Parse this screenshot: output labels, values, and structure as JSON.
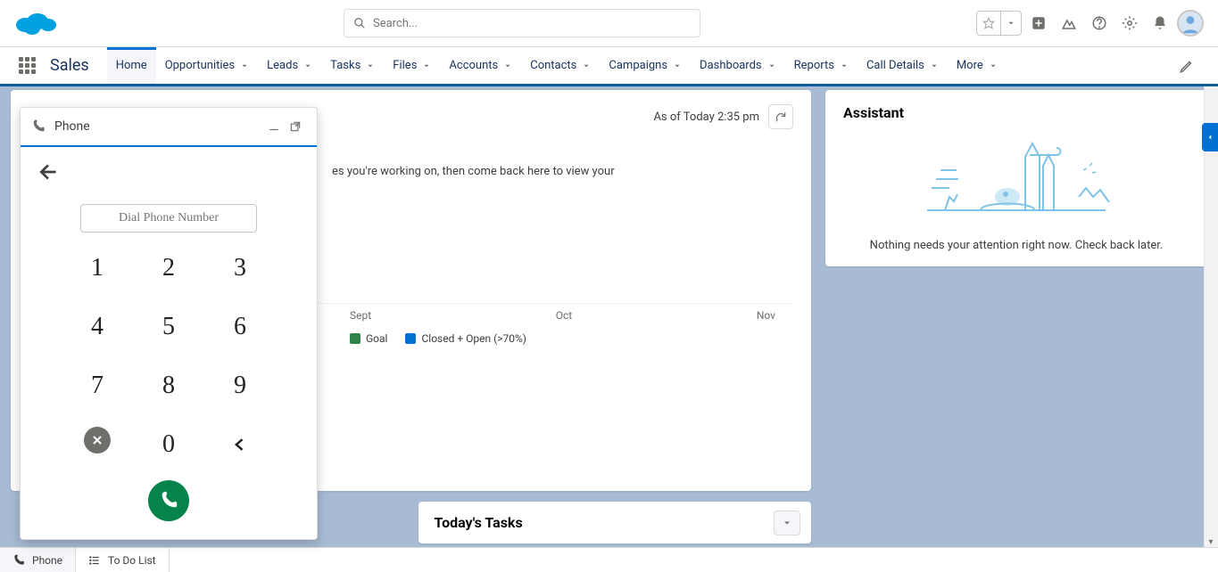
{
  "header": {
    "search_placeholder": "Search..."
  },
  "nav": {
    "app_name": "Sales",
    "items": [
      "Home",
      "Opportunities",
      "Leads",
      "Tasks",
      "Files",
      "Accounts",
      "Contacts",
      "Campaigns",
      "Dashboards",
      "Reports",
      "Call Details",
      "More"
    ],
    "active": "Home"
  },
  "perf": {
    "asof": "As of Today 2:35 pm",
    "hint": "es you're working on, then come back here to view your",
    "months": [
      "Sept",
      "Oct",
      "Nov"
    ],
    "legend": [
      {
        "label": "Goal",
        "color": "#2e844a"
      },
      {
        "label": "Closed + Open (>70%)",
        "color": "#0070d2"
      }
    ]
  },
  "tasks": {
    "title": "Today's Tasks"
  },
  "assistant": {
    "title": "Assistant",
    "message": "Nothing needs your attention right now. Check back later."
  },
  "softphone": {
    "title": "Phone",
    "dial_placeholder": "Dial Phone Number",
    "keys": [
      "1",
      "2",
      "3",
      "4",
      "5",
      "6",
      "7",
      "8",
      "9",
      "✕",
      "0",
      "‹"
    ]
  },
  "utilbar": {
    "items": [
      {
        "label": "Phone",
        "icon": "phone"
      },
      {
        "label": "To Do List",
        "icon": "list"
      }
    ]
  }
}
